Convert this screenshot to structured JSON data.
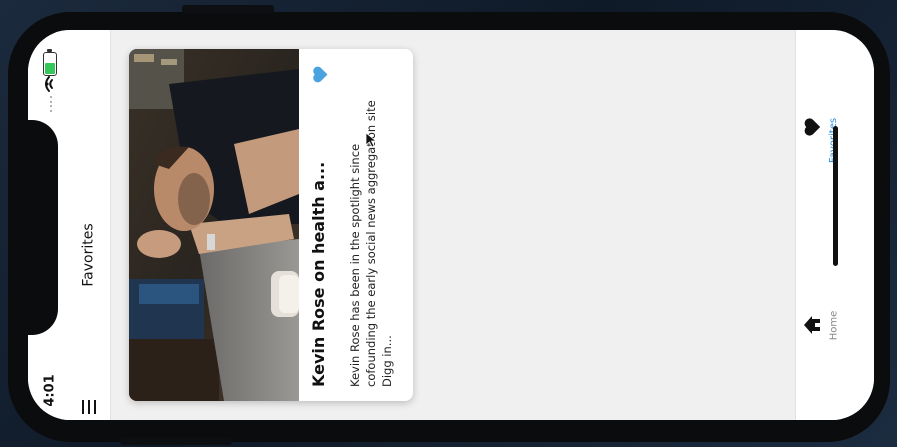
{
  "status_bar": {
    "time": "4:01",
    "battery_icon": "battery-icon",
    "wifi_icon": "wifi-icon"
  },
  "nav_bar": {
    "title": "Favorites",
    "menu_icon": "menu-icon"
  },
  "card": {
    "title": "Kevin Rose on health a...",
    "description_lines": [
      "Kevin Rose has been in the spotlight since",
      "cofounding the early social news aggregation site",
      "Digg in..."
    ],
    "favorite_icon": "heart-icon",
    "favorite_color": "#4aa3df",
    "image_subject": "man-leaning-on-bar-photo"
  },
  "tab_bar": {
    "tabs": [
      {
        "label": "Favorites",
        "icon": "heart-icon",
        "active": true,
        "color": "#2f8fdc"
      },
      {
        "label": "Home",
        "icon": "home-icon",
        "active": false,
        "color": "#888888"
      }
    ]
  }
}
